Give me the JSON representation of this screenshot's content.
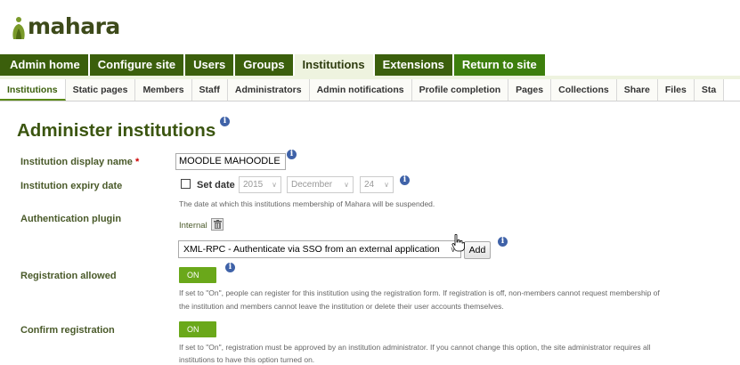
{
  "brand": {
    "logo_text": "mahara",
    "accent": "#3b5f0c",
    "logo_green": "#7a9a2a"
  },
  "main_nav": [
    {
      "label": "Admin home"
    },
    {
      "label": "Configure site"
    },
    {
      "label": "Users"
    },
    {
      "label": "Groups"
    },
    {
      "label": "Institutions",
      "active": true
    },
    {
      "label": "Extensions"
    },
    {
      "label": "Return to site"
    }
  ],
  "sub_nav": [
    {
      "label": "Institutions",
      "active": true
    },
    {
      "label": "Static pages"
    },
    {
      "label": "Members"
    },
    {
      "label": "Staff"
    },
    {
      "label": "Administrators"
    },
    {
      "label": "Admin notifications"
    },
    {
      "label": "Profile completion"
    },
    {
      "label": "Pages"
    },
    {
      "label": "Collections"
    },
    {
      "label": "Share"
    },
    {
      "label": "Files"
    },
    {
      "label": "Sta"
    }
  ],
  "page": {
    "title": "Administer institutions"
  },
  "form": {
    "display_name": {
      "label": "Institution display name",
      "required_mark": "*",
      "value": "MOODLE MAHOODLE"
    },
    "expiry": {
      "label": "Institution expiry date",
      "set_date_label": "Set date",
      "year": "2015",
      "month": "December",
      "day": "24",
      "description": "The date at which this institutions membership of Mahara will be suspended."
    },
    "auth": {
      "label": "Authentication plugin",
      "current": "Internal",
      "select_value": "XML-RPC - Authenticate via SSO from an external application",
      "add_label": "Add"
    },
    "registration": {
      "label": "Registration allowed",
      "toggle": "ON",
      "desc_line1": "If set to \"On\", people can register for this institution using the registration form. If registration is off, non-members cannot request membership of",
      "desc_line2": "the institution and members cannot leave the institution or delete their user accounts themselves."
    },
    "confirm": {
      "label": "Confirm registration",
      "toggle": "ON",
      "desc_line1": "If set to \"On\", registration must be approved by an institution administrator. If you cannot change this option, the site administrator requires all",
      "desc_line2": "institutions to have this option turned on."
    }
  }
}
